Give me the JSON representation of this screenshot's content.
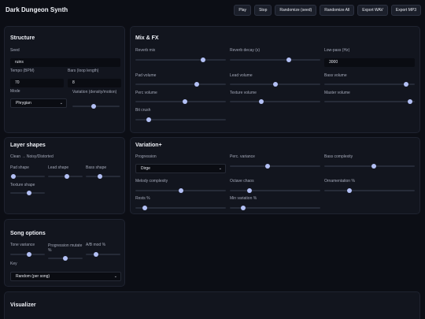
{
  "app": {
    "title": "Dark Dungeon Synth"
  },
  "toolbar": {
    "play": "Play",
    "stop": "Stop",
    "randomize_seed": "Randomize (seed)",
    "randomize_all": "Randomize All",
    "export_wav": "Export WAV",
    "export_mp3": "Export MP3"
  },
  "structure": {
    "title": "Structure",
    "seed_label": "Seed",
    "seed_value": "ruins",
    "tempo_label": "Tempo (BPM)",
    "tempo_value": "70",
    "bars_label": "Bars (loop length)",
    "bars_value": "8",
    "mode_label": "Mode",
    "mode_value": "Phrygian",
    "variation_label": "Variation (density/motion)",
    "variation_level": 0.45
  },
  "mix": {
    "title": "Mix & FX",
    "reverb_mix_label": "Reverb mix",
    "reverb_mix_level": 0.75,
    "reverb_decay_label": "Reverb decay (s)",
    "reverb_decay_level": 0.65,
    "lowpass_label": "Low-pass (Hz)",
    "lowpass_value": "3000",
    "pad_volume_label": "Pad volume",
    "pad_volume_level": 0.68,
    "lead_volume_label": "Lead volume",
    "lead_volume_level": 0.5,
    "bass_volume_label": "Bass volume",
    "bass_volume_level": 0.9,
    "perc_volume_label": "Perc volume",
    "perc_volume_level": 0.55,
    "texture_volume_label": "Texture volume",
    "texture_volume_level": 0.35,
    "master_volume_label": "Master volume",
    "master_volume_level": 0.95,
    "bitcrush_label": "Bit crush",
    "bitcrush_level": 0.15
  },
  "layers": {
    "title": "Layer shapes",
    "subtitle": "Clean → Noisy/Distorted",
    "pad_shape_label": "Pad shape",
    "pad_shape_level": 0.1,
    "lead_shape_label": "Lead shape",
    "lead_shape_level": 0.55,
    "bass_shape_label": "Bass shape",
    "bass_shape_level": 0.4,
    "texture_shape_label": "Texture shape",
    "texture_shape_level": 0.55
  },
  "variation": {
    "title": "Variation+",
    "progression_label": "Progression",
    "progression_value": "Dirge",
    "perc_variance_label": "Perc. variance",
    "perc_variance_level": 0.42,
    "bass_complexity_label": "Bass complexity",
    "bass_complexity_level": 0.55,
    "melody_complexity_label": "Melody complexity",
    "melody_complexity_level": 0.5,
    "octave_chaos_label": "Octave chaos",
    "octave_chaos_level": 0.22,
    "ornamentation_label": "Ornamentation %",
    "ornamentation_level": 0.28,
    "rests_label": "Rests %",
    "rests_level": 0.1,
    "min_variation_label": "Min variation %",
    "min_variation_level": 0.15
  },
  "song": {
    "title": "Song options",
    "tone_variance_label": "Tone variance",
    "tone_variance_level": 0.55,
    "progression_mutate_label": "Progression mutate %",
    "progression_mutate_level": 0.5,
    "ab_mod_label": "A/B mod %",
    "ab_mod_level": 0.3,
    "key_label": "Key",
    "key_value": "Random (per song)"
  },
  "visualizer": {
    "title": "Visualizer"
  }
}
